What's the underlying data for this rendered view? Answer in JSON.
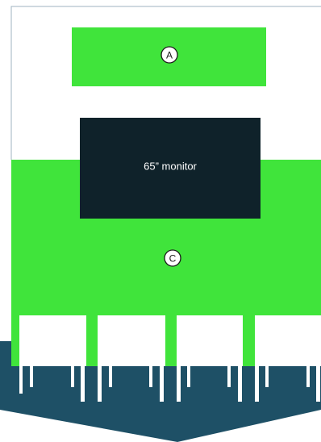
{
  "diagram": {
    "zone_a": {
      "marker": "A"
    },
    "zone_c": {
      "marker": "C"
    },
    "monitor": {
      "label": "65” monitor"
    },
    "colors": {
      "zone": "#40e43b",
      "monitor": "#0f222a",
      "table": "#1e5066",
      "room_outline": "#9fb3c0",
      "seat": "#ffffff"
    },
    "seats": 4
  }
}
